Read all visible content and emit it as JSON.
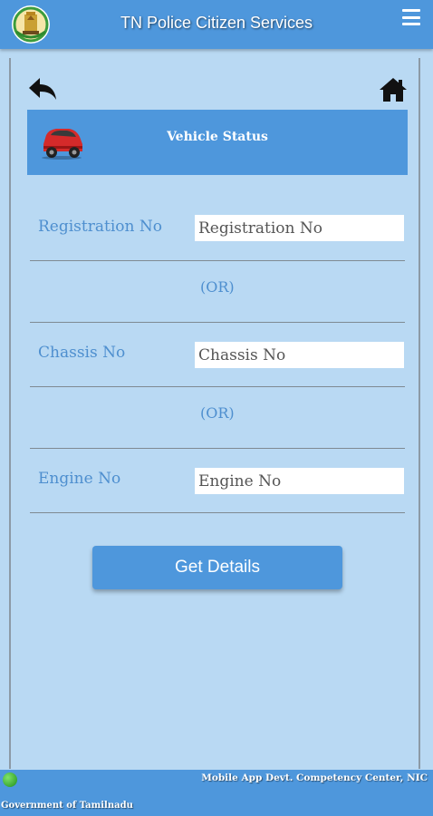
{
  "app_bar": {
    "title": "TN Police Citizen Services",
    "logo_icon": "tamil-nadu-emblem-icon",
    "menu_icon": "hamburger-menu-icon"
  },
  "nav": {
    "back_icon": "back-arrow-icon",
    "home_icon": "home-icon"
  },
  "banner": {
    "icon": "car-icon",
    "title": "Vehicle Status"
  },
  "form": {
    "registration": {
      "label": "Registration No",
      "placeholder": "Registration No",
      "value": ""
    },
    "separator_1": "(OR)",
    "chassis": {
      "label": "Chassis No",
      "placeholder": "Chassis No",
      "value": ""
    },
    "separator_2": "(OR)",
    "engine": {
      "label": "Engine No",
      "placeholder": "Engine No",
      "value": ""
    },
    "submit_label": "Get Details"
  },
  "footer": {
    "org": "Mobile App Devt. Competency Center, NIC",
    "gov": "Government of Tamilnadu",
    "status_icon": "online-status-dot-icon"
  },
  "colors": {
    "primary": "#4e97dc",
    "background": "#b9d9f3",
    "label_text": "#4e8fcf"
  }
}
